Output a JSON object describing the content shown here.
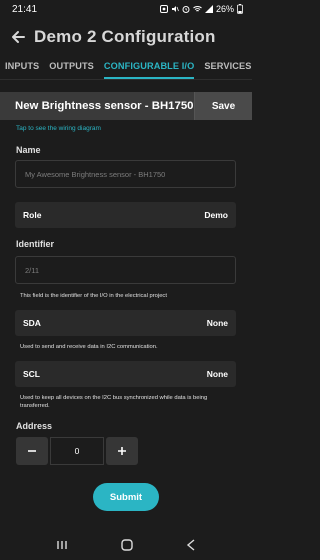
{
  "status_bar": {
    "time": "21:41",
    "battery": "26%",
    "icons": [
      "notification-icon",
      "wifi-icon",
      "mute-icon",
      "alarm-icon",
      "signal-icon",
      "battery-icon"
    ]
  },
  "header": {
    "title": "Demo 2 Configuration"
  },
  "tabs": [
    {
      "label": "INPUTS",
      "active": false
    },
    {
      "label": "OUTPUTS",
      "active": false
    },
    {
      "label": "CONFIGURABLE I/O",
      "active": true
    },
    {
      "label": "SERVICES",
      "active": false
    }
  ],
  "sensor": {
    "name": "New Brightness sensor - BH1750",
    "save_label": "Save",
    "wiring_link": "Tap to see the wiring diagram"
  },
  "form": {
    "name_label": "Name",
    "name_placeholder": "My Awesome Brightness sensor - BH1750",
    "role_label": "Role",
    "role_value": "Demo",
    "identifier_label": "Identifier",
    "identifier_placeholder": "2/11",
    "identifier_help": "This field is the identifier of the I/O in the electrical project",
    "sda_label": "SDA",
    "sda_value": "None",
    "sda_help": "Used to send and receive data in I2C communication.",
    "scl_label": "SCL",
    "scl_value": "None",
    "scl_help": "Used to keep all devices on the I2C bus synchronized while data is being transferred.",
    "address_label": "Address",
    "address_value": "0",
    "submit_label": "Submit"
  },
  "colors": {
    "accent": "#2bb5c4",
    "background": "#1c1c1c",
    "bar": "#3a3a3a"
  }
}
